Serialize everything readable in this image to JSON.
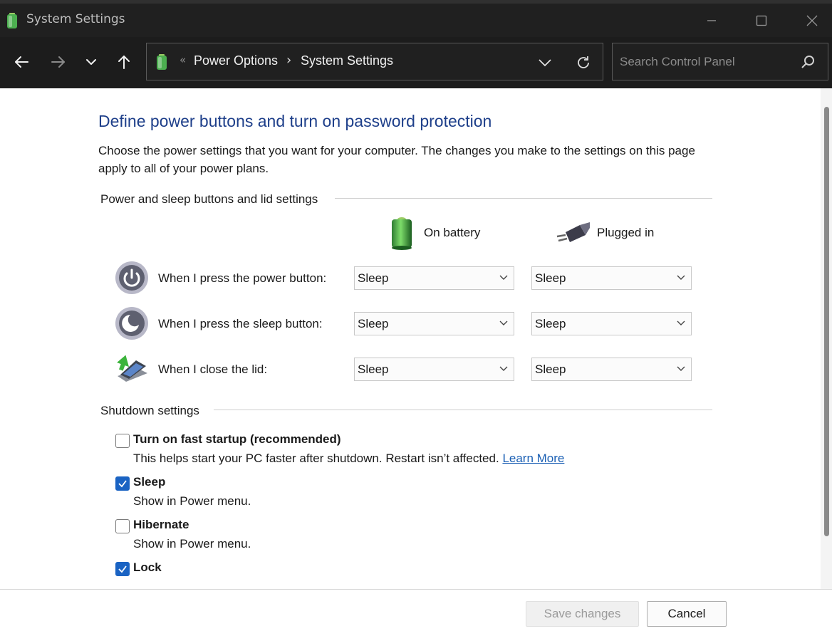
{
  "window": {
    "title": "System Settings",
    "app_icon": "battery-icon",
    "controls": [
      "minimize-icon",
      "maximize-icon",
      "close-icon"
    ]
  },
  "navbar": {
    "buttons": [
      "back-arrow-icon",
      "forward-arrow-icon",
      "recent-locations-chevron-icon",
      "up-arrow-icon"
    ],
    "address": {
      "overflow": "«",
      "crumbs": [
        "Power Options",
        "System Settings"
      ],
      "separator": "›"
    },
    "search": {
      "placeholder": "Search Control Panel",
      "value": ""
    }
  },
  "page": {
    "title": "Define power buttons and turn on password protection",
    "description": "Choose the power settings that you want for your computer. The changes you make to the settings on this page apply to all of your power plans."
  },
  "power_section": {
    "header": "Power and sleep buttons and lid settings",
    "columns": {
      "battery": "On battery",
      "plugged": "Plugged in"
    },
    "rows": [
      {
        "label": "When I press the power button:",
        "icon": "power-button-icon",
        "battery": "Sleep",
        "plugged": "Sleep"
      },
      {
        "label": "When I press the sleep button:",
        "icon": "sleep-button-icon",
        "battery": "Sleep",
        "plugged": "Sleep"
      },
      {
        "label": "When I close the lid:",
        "icon": "laptop-lid-icon",
        "battery": "Sleep",
        "plugged": "Sleep"
      }
    ]
  },
  "shutdown_section": {
    "header": "Shutdown settings",
    "items": [
      {
        "label": "Turn on fast startup (recommended)",
        "checked": false,
        "description": "This helps start your PC faster after shutdown. Restart isn’t affected.",
        "link": "Learn More"
      },
      {
        "label": "Sleep",
        "checked": true,
        "description": "Show in Power menu."
      },
      {
        "label": "Hibernate",
        "checked": false,
        "description": "Show in Power menu."
      },
      {
        "label": "Lock",
        "checked": true
      }
    ]
  },
  "footer": {
    "save": "Save changes",
    "cancel": "Cancel"
  },
  "colors": {
    "title_blue": "#1e3f8a",
    "checkbox_blue": "#1a63c3",
    "link_blue": "#1a5fb4",
    "titlebar": "#202020"
  }
}
